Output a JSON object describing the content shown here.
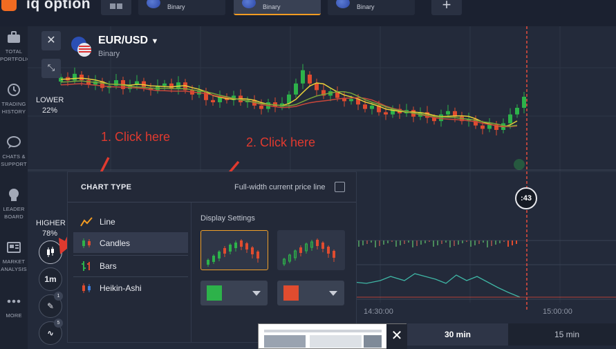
{
  "app": {
    "logo_text": "iq option"
  },
  "tabs": [
    {
      "label": "Binary"
    },
    {
      "label": "Binary",
      "active": true
    },
    {
      "label": "Binary"
    }
  ],
  "sidebar": {
    "items": [
      {
        "label": "TOTAL\nPORTFOLIO",
        "icon": "briefcase-icon"
      },
      {
        "label": "TRADING\nHISTORY",
        "icon": "clock-icon"
      },
      {
        "label": "CHATS &\nSUPPORT",
        "icon": "chat-icon"
      },
      {
        "label": "LEADER\nBOARD",
        "icon": "trophy-icon"
      },
      {
        "label": "MARKET\nANALYSIS",
        "icon": "newspaper-icon"
      },
      {
        "label": "MORE",
        "icon": "dots-icon"
      }
    ]
  },
  "asset": {
    "name": "EUR/USD",
    "type": "Binary"
  },
  "sentiment": {
    "lower_label": "LOWER",
    "lower_pct": "22%",
    "higher_label": "HIGHER",
    "higher_pct": "78%"
  },
  "timer": {
    "text": ":43"
  },
  "tools": {
    "interval": "1m",
    "draw_badge": "1",
    "indicator_badge": "5"
  },
  "time_axis": {
    "t1": "14:30:00",
    "t2": "15:00:00"
  },
  "periods": [
    {
      "label": "30 min",
      "active": true
    },
    {
      "label": "15 min"
    }
  ],
  "annotations": {
    "step1": "1. Click here",
    "step2": "2. Click here"
  },
  "panel": {
    "title": "CHART TYPE",
    "full_width_label": "Full-width current price line",
    "display_settings": "Display Settings",
    "types": [
      {
        "label": "Line",
        "icon": "line-chart-icon"
      },
      {
        "label": "Candles",
        "icon": "candles-icon",
        "active": true
      },
      {
        "label": "Bars",
        "icon": "bars-icon"
      },
      {
        "label": "Heikin-Ashi",
        "icon": "heikin-ashi-icon"
      }
    ],
    "colors": {
      "up": "#2db24a",
      "down": "#e04c2f"
    }
  },
  "colors": {
    "accent": "#f49c22",
    "up": "#2db24a",
    "down": "#e04c2f",
    "annotation": "#e03a2f"
  }
}
